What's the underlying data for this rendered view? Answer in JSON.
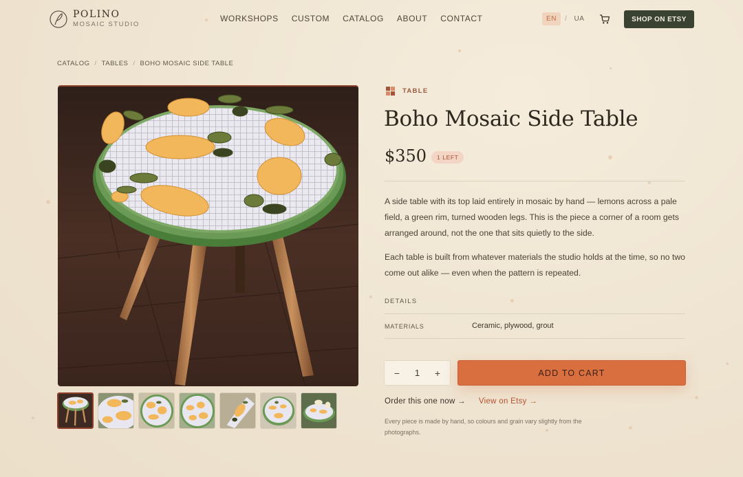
{
  "brand": {
    "name": "POLINO",
    "subtitle": "MOSAIC STUDIO"
  },
  "nav": [
    "WORKSHOPS",
    "CUSTOM",
    "CATALOG",
    "ABOUT",
    "CONTACT"
  ],
  "lang": {
    "active": "EN",
    "other": "UA",
    "separator": "/"
  },
  "header": {
    "shop_button": "SHOP ON ETSY",
    "cart_icon": "cart-icon"
  },
  "breadcrumb": [
    "CATALOG",
    "TABLES",
    "BOHO MOSAIC SIDE TABLE"
  ],
  "product": {
    "category": "TABLE",
    "title": "Boho Mosaic Side Table",
    "price": "$350",
    "stock": "1 LEFT",
    "description": [
      "A side table with its top laid entirely in mosaic by hand — lemons across a pale field, a green rim, turned wooden legs. This is the piece a corner of a room gets arranged around, not the one that sits quietly to the side.",
      "Each table is built from whatever materials the studio holds at the time, so no two come out alike — even when the pattern is repeated."
    ],
    "details_heading": "DETAILS",
    "details": [
      {
        "key": "MATERIALS",
        "value": "Ceramic, plywood, grout"
      }
    ],
    "quantity": "1",
    "qty_minus": "−",
    "qty_plus": "+",
    "add_to_cart": "ADD TO CART",
    "order_link": "Order this one now →",
    "etsy_link": "View on Etsy →",
    "note": "Every piece is made by hand, so colours and grain vary slightly from the photographs."
  },
  "gallery": {
    "thumbnail_count": 7,
    "active_thumbnail": 1
  },
  "colors": {
    "accent": "#d96e3e",
    "dark_green": "#3a4331",
    "rust": "#8d3f2a",
    "background": "#f0e6d4"
  }
}
